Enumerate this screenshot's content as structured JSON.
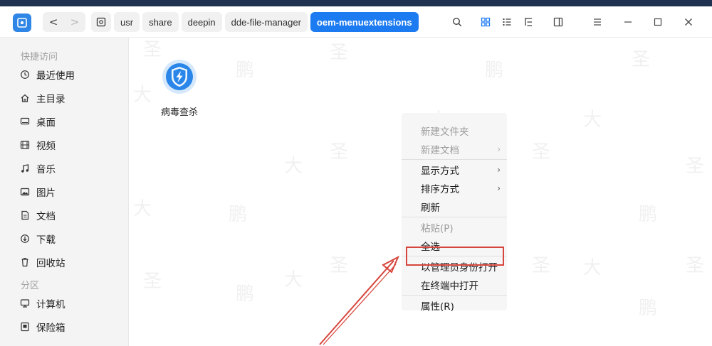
{
  "nav": {
    "back": "<",
    "forward": ">"
  },
  "breadcrumbs": [
    {
      "label": "usr",
      "active": false
    },
    {
      "label": "share",
      "active": false
    },
    {
      "label": "deepin",
      "active": false
    },
    {
      "label": "dde-file-manager",
      "active": false
    },
    {
      "label": "oem-menuextensions",
      "active": true
    }
  ],
  "sidebar": {
    "sections": [
      {
        "title": "快捷访问",
        "items": [
          {
            "label": "最近使用",
            "icon": "clock-icon"
          },
          {
            "label": "主目录",
            "icon": "home-icon"
          },
          {
            "label": "桌面",
            "icon": "desktop-icon"
          },
          {
            "label": "视频",
            "icon": "video-icon"
          },
          {
            "label": "音乐",
            "icon": "music-icon"
          },
          {
            "label": "图片",
            "icon": "image-icon"
          },
          {
            "label": "文档",
            "icon": "document-icon"
          },
          {
            "label": "下载",
            "icon": "download-icon"
          },
          {
            "label": "回收站",
            "icon": "trash-icon"
          }
        ]
      },
      {
        "title": "分区",
        "items": [
          {
            "label": "计算机",
            "icon": "computer-icon"
          },
          {
            "label": "保险箱",
            "icon": "vault-icon"
          }
        ]
      }
    ]
  },
  "files": [
    {
      "name": "病毒查杀",
      "icon": "antivirus-shield-icon"
    }
  ],
  "context_menu": {
    "groups": [
      [
        {
          "label": "新建文件夹",
          "disabled": true,
          "submenu": false
        },
        {
          "label": "新建文档",
          "disabled": true,
          "submenu": true
        }
      ],
      [
        {
          "label": "显示方式",
          "disabled": false,
          "submenu": true
        },
        {
          "label": "排序方式",
          "disabled": false,
          "submenu": true
        },
        {
          "label": "刷新",
          "disabled": false,
          "submenu": false
        }
      ],
      [
        {
          "label": "粘贴(P)",
          "disabled": true,
          "submenu": false
        },
        {
          "label": "全选",
          "disabled": false,
          "submenu": false
        }
      ],
      [
        {
          "label": "以管理员身份打开",
          "disabled": false,
          "submenu": false,
          "highlighted": true
        },
        {
          "label": "在终端中打开",
          "disabled": false,
          "submenu": false
        }
      ],
      [
        {
          "label": "属性(R)",
          "disabled": false,
          "submenu": false
        }
      ]
    ],
    "chevron": "›"
  },
  "watermark": {
    "chars": [
      "大",
      "鹏",
      "圣"
    ]
  },
  "colors": {
    "accent": "#1d7bf2",
    "annotation": "#d7453c",
    "logo": "#2f86e6"
  }
}
